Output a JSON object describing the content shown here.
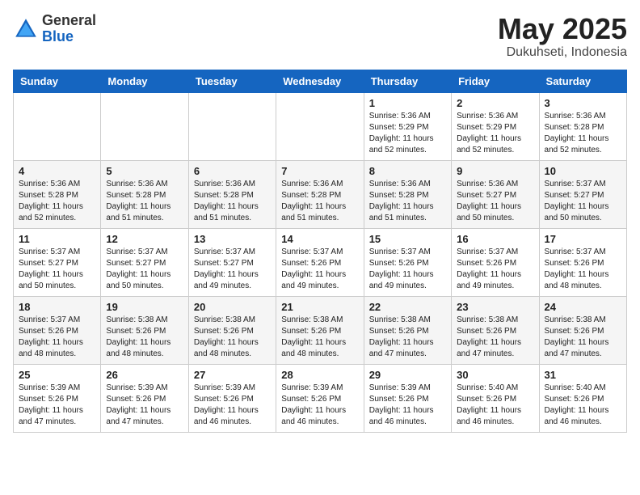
{
  "header": {
    "logo_general": "General",
    "logo_blue": "Blue",
    "month": "May 2025",
    "location": "Dukuhseti, Indonesia"
  },
  "weekdays": [
    "Sunday",
    "Monday",
    "Tuesday",
    "Wednesday",
    "Thursday",
    "Friday",
    "Saturday"
  ],
  "rows": [
    [
      {
        "day": "",
        "info": ""
      },
      {
        "day": "",
        "info": ""
      },
      {
        "day": "",
        "info": ""
      },
      {
        "day": "",
        "info": ""
      },
      {
        "day": "1",
        "info": "Sunrise: 5:36 AM\nSunset: 5:29 PM\nDaylight: 11 hours\nand 52 minutes."
      },
      {
        "day": "2",
        "info": "Sunrise: 5:36 AM\nSunset: 5:29 PM\nDaylight: 11 hours\nand 52 minutes."
      },
      {
        "day": "3",
        "info": "Sunrise: 5:36 AM\nSunset: 5:28 PM\nDaylight: 11 hours\nand 52 minutes."
      }
    ],
    [
      {
        "day": "4",
        "info": "Sunrise: 5:36 AM\nSunset: 5:28 PM\nDaylight: 11 hours\nand 52 minutes."
      },
      {
        "day": "5",
        "info": "Sunrise: 5:36 AM\nSunset: 5:28 PM\nDaylight: 11 hours\nand 51 minutes."
      },
      {
        "day": "6",
        "info": "Sunrise: 5:36 AM\nSunset: 5:28 PM\nDaylight: 11 hours\nand 51 minutes."
      },
      {
        "day": "7",
        "info": "Sunrise: 5:36 AM\nSunset: 5:28 PM\nDaylight: 11 hours\nand 51 minutes."
      },
      {
        "day": "8",
        "info": "Sunrise: 5:36 AM\nSunset: 5:28 PM\nDaylight: 11 hours\nand 51 minutes."
      },
      {
        "day": "9",
        "info": "Sunrise: 5:36 AM\nSunset: 5:27 PM\nDaylight: 11 hours\nand 50 minutes."
      },
      {
        "day": "10",
        "info": "Sunrise: 5:37 AM\nSunset: 5:27 PM\nDaylight: 11 hours\nand 50 minutes."
      }
    ],
    [
      {
        "day": "11",
        "info": "Sunrise: 5:37 AM\nSunset: 5:27 PM\nDaylight: 11 hours\nand 50 minutes."
      },
      {
        "day": "12",
        "info": "Sunrise: 5:37 AM\nSunset: 5:27 PM\nDaylight: 11 hours\nand 50 minutes."
      },
      {
        "day": "13",
        "info": "Sunrise: 5:37 AM\nSunset: 5:27 PM\nDaylight: 11 hours\nand 49 minutes."
      },
      {
        "day": "14",
        "info": "Sunrise: 5:37 AM\nSunset: 5:26 PM\nDaylight: 11 hours\nand 49 minutes."
      },
      {
        "day": "15",
        "info": "Sunrise: 5:37 AM\nSunset: 5:26 PM\nDaylight: 11 hours\nand 49 minutes."
      },
      {
        "day": "16",
        "info": "Sunrise: 5:37 AM\nSunset: 5:26 PM\nDaylight: 11 hours\nand 49 minutes."
      },
      {
        "day": "17",
        "info": "Sunrise: 5:37 AM\nSunset: 5:26 PM\nDaylight: 11 hours\nand 48 minutes."
      }
    ],
    [
      {
        "day": "18",
        "info": "Sunrise: 5:37 AM\nSunset: 5:26 PM\nDaylight: 11 hours\nand 48 minutes."
      },
      {
        "day": "19",
        "info": "Sunrise: 5:38 AM\nSunset: 5:26 PM\nDaylight: 11 hours\nand 48 minutes."
      },
      {
        "day": "20",
        "info": "Sunrise: 5:38 AM\nSunset: 5:26 PM\nDaylight: 11 hours\nand 48 minutes."
      },
      {
        "day": "21",
        "info": "Sunrise: 5:38 AM\nSunset: 5:26 PM\nDaylight: 11 hours\nand 48 minutes."
      },
      {
        "day": "22",
        "info": "Sunrise: 5:38 AM\nSunset: 5:26 PM\nDaylight: 11 hours\nand 47 minutes."
      },
      {
        "day": "23",
        "info": "Sunrise: 5:38 AM\nSunset: 5:26 PM\nDaylight: 11 hours\nand 47 minutes."
      },
      {
        "day": "24",
        "info": "Sunrise: 5:38 AM\nSunset: 5:26 PM\nDaylight: 11 hours\nand 47 minutes."
      }
    ],
    [
      {
        "day": "25",
        "info": "Sunrise: 5:39 AM\nSunset: 5:26 PM\nDaylight: 11 hours\nand 47 minutes."
      },
      {
        "day": "26",
        "info": "Sunrise: 5:39 AM\nSunset: 5:26 PM\nDaylight: 11 hours\nand 47 minutes."
      },
      {
        "day": "27",
        "info": "Sunrise: 5:39 AM\nSunset: 5:26 PM\nDaylight: 11 hours\nand 46 minutes."
      },
      {
        "day": "28",
        "info": "Sunrise: 5:39 AM\nSunset: 5:26 PM\nDaylight: 11 hours\nand 46 minutes."
      },
      {
        "day": "29",
        "info": "Sunrise: 5:39 AM\nSunset: 5:26 PM\nDaylight: 11 hours\nand 46 minutes."
      },
      {
        "day": "30",
        "info": "Sunrise: 5:40 AM\nSunset: 5:26 PM\nDaylight: 11 hours\nand 46 minutes."
      },
      {
        "day": "31",
        "info": "Sunrise: 5:40 AM\nSunset: 5:26 PM\nDaylight: 11 hours\nand 46 minutes."
      }
    ]
  ]
}
